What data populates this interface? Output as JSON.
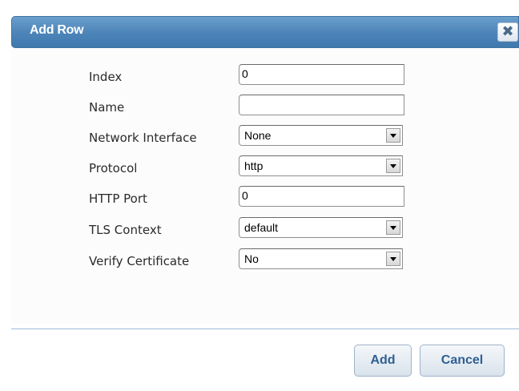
{
  "dialog": {
    "title": "Add Row",
    "close_glyph": "✖",
    "close_icon": "close-icon"
  },
  "fields": [
    {
      "label": "Index",
      "type": "text",
      "value": "0"
    },
    {
      "label": "Name",
      "type": "text",
      "value": ""
    },
    {
      "label": "Network Interface",
      "type": "select",
      "value": "None"
    },
    {
      "label": "Protocol",
      "type": "select",
      "value": "http"
    },
    {
      "label": "HTTP Port",
      "type": "text",
      "value": "0"
    },
    {
      "label": "TLS Context",
      "type": "select",
      "value": "default"
    },
    {
      "label": "Verify Certificate",
      "type": "select",
      "value": "No"
    }
  ],
  "buttons": {
    "add_label": "Add",
    "cancel_label": "Cancel"
  },
  "colors": {
    "titlebar": "#4e86ba",
    "button_text": "#2f5f92",
    "divider": "#9fbcd8"
  }
}
